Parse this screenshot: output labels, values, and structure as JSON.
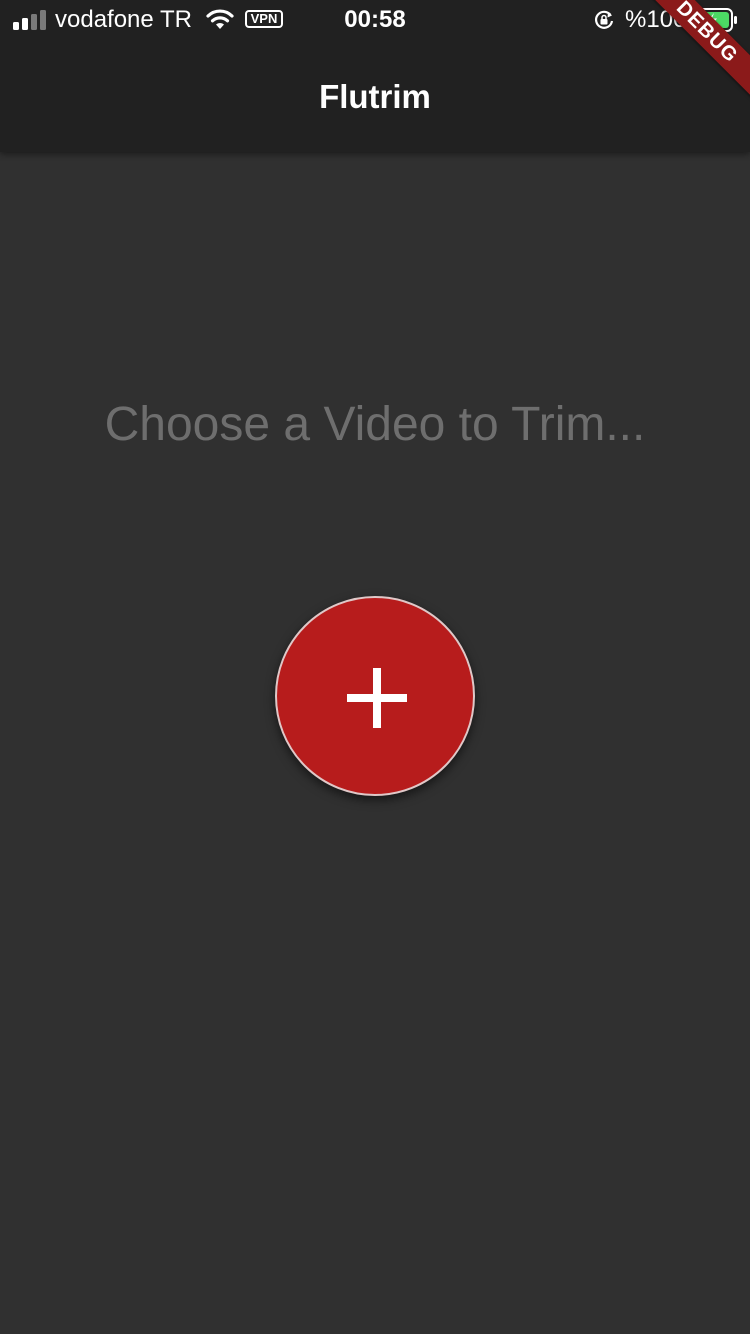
{
  "status_bar": {
    "carrier": "vodafone TR",
    "vpn_label": "VPN",
    "time": "00:58",
    "battery_percent": "%100",
    "signal_bars_filled": 2,
    "signal_bars_total": 4,
    "icons": [
      "signal-icon",
      "wifi-icon",
      "rotation-lock-icon",
      "battery-charging-icon"
    ]
  },
  "app_bar": {
    "title": "Flutrim"
  },
  "debug_banner": {
    "label": "DEBUG"
  },
  "main": {
    "prompt": "Choose a Video to Trim...",
    "add_button_icon": "plus-icon"
  },
  "colors": {
    "background": "#303030",
    "app_bar": "#212121",
    "accent": "#b71c1c",
    "prompt_text": "#6e6e6e",
    "battery_fill": "#4cd964"
  }
}
